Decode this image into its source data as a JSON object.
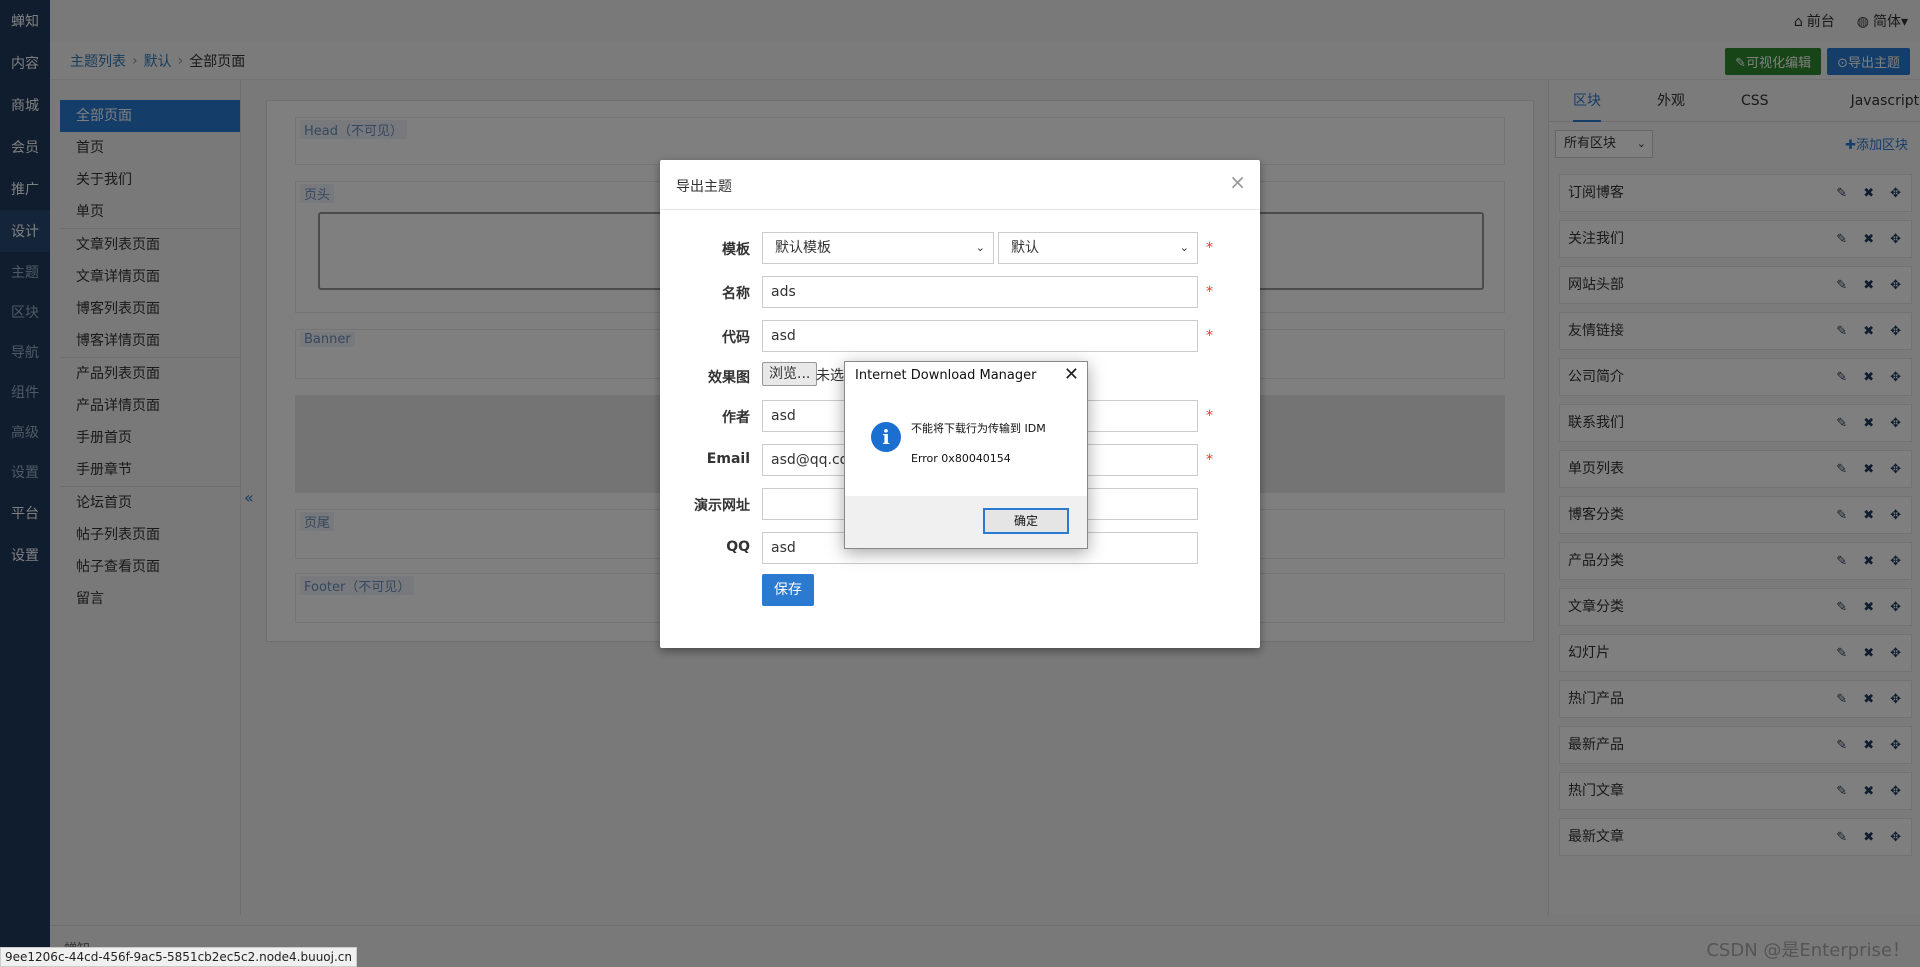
{
  "leftnav": {
    "brand": "蝉知",
    "items": [
      "内容",
      "商城",
      "会员",
      "推广",
      "设计"
    ],
    "subitems": [
      "主题",
      "区块",
      "导航",
      "组件",
      "高级",
      "设置"
    ],
    "bottom": [
      "平台",
      "设置"
    ]
  },
  "topbar": {
    "frontend": "前台",
    "language": "简体"
  },
  "breadcrumb": {
    "root": "主题列表",
    "theme": "默认",
    "current": "全部页面"
  },
  "actions": {
    "visual_edit": "可视化编辑",
    "export_theme": "导出主题"
  },
  "pages": [
    {
      "label": "全部页面"
    },
    {
      "label": "首页"
    },
    {
      "label": "关于我们"
    },
    {
      "label": "单页"
    },
    {
      "label": "文章列表页面"
    },
    {
      "label": "文章详情页面"
    },
    {
      "label": "博客列表页面"
    },
    {
      "label": "博客详情页面"
    },
    {
      "label": "产品列表页面"
    },
    {
      "label": "产品详情页面"
    },
    {
      "label": "手册首页"
    },
    {
      "label": "手册章节"
    },
    {
      "label": "论坛首页"
    },
    {
      "label": "帖子列表页面"
    },
    {
      "label": "帖子查看页面"
    },
    {
      "label": "留言"
    }
  ],
  "regions": {
    "head": "Head（不可见）",
    "header": "页头",
    "banner": "Banner",
    "footer": "页尾",
    "footer_invisible": "Footer（不可见）"
  },
  "rightpanel": {
    "tabs": [
      "区块",
      "外观",
      "CSS",
      "Javascript"
    ],
    "filter": "所有区块",
    "add_block": "添加区块",
    "blocks": [
      "订阅博客",
      "关注我们",
      "网站头部",
      "友情链接",
      "公司简介",
      "联系我们",
      "单页列表",
      "博客分类",
      "产品分类",
      "文章分类",
      "幻灯片",
      "热门产品",
      "最新产品",
      "热门文章",
      "最新文章"
    ]
  },
  "footer": {
    "text": "蝉知"
  },
  "status_url": "9ee1206c-44cd-456f-9ac5-5851cb2ec5c2.node4.buuoj.cn",
  "watermark": "CSDN @是Enterprise！",
  "modal": {
    "title": "导出主题",
    "close": "×",
    "labels": {
      "template": "模板",
      "name": "名称",
      "code": "代码",
      "preview": "效果图",
      "author": "作者",
      "email": "Email",
      "demo_url": "演示网址",
      "qq": "QQ"
    },
    "template_value": "默认模板",
    "theme_value": "默认",
    "name_value": "ads",
    "code_value": "asd",
    "browse_label": "浏览...",
    "file_status": "未选择",
    "author_value": "asd",
    "email_value": "asd@qq.com",
    "demo_url_value": "",
    "qq_value": "asd",
    "required_mark": "*",
    "save_label": "保存"
  },
  "idm": {
    "title": "Internet Download Manager",
    "close": "✕",
    "message": "不能将下载行为传输到 IDM",
    "error": "Error 0x80040154",
    "ok": "确定"
  }
}
